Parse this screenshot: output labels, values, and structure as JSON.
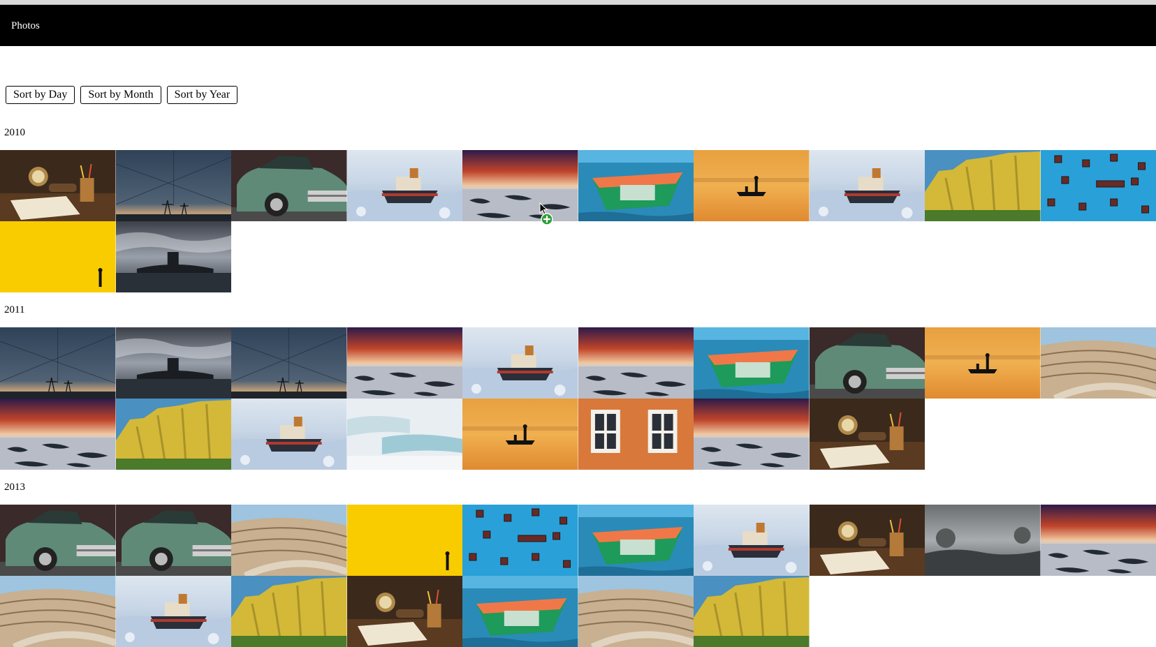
{
  "app": {
    "title": "Photos"
  },
  "sort_buttons": [
    {
      "label": "Sort by Day"
    },
    {
      "label": "Sort by Month"
    },
    {
      "label": "Sort by Year"
    }
  ],
  "groups": [
    {
      "year": "2010",
      "photos": [
        "still-life",
        "power-lines",
        "vintage-car",
        "icebreaker",
        "sunset-ice",
        "green-boat",
        "fisherman-orange",
        "icebreaker",
        "yellow-hills",
        "blue-windows",
        "yellow-wall",
        "submarine"
      ]
    },
    {
      "year": "2011",
      "photos": [
        "power-lines",
        "submarine",
        "power-lines",
        "sunset-ice",
        "icebreaker",
        "sunset-ice",
        "green-boat",
        "vintage-car",
        "fisherman-orange",
        "amphitheater",
        "sunset-ice",
        "yellow-hills",
        "icebreaker",
        "white-terraces",
        "fisherman-orange",
        "orange-windows",
        "sunset-ice",
        "still-life"
      ]
    },
    {
      "year": "2013",
      "photos": [
        "vintage-car",
        "vintage-car",
        "amphitheater",
        "yellow-wall",
        "blue-windows",
        "green-boat",
        "icebreaker",
        "still-life",
        "grey-field",
        "sunset-ice",
        "amphitheater",
        "icebreaker",
        "yellow-hills",
        "still-life",
        "green-boat",
        "amphitheater",
        "yellow-hills"
      ]
    }
  ]
}
